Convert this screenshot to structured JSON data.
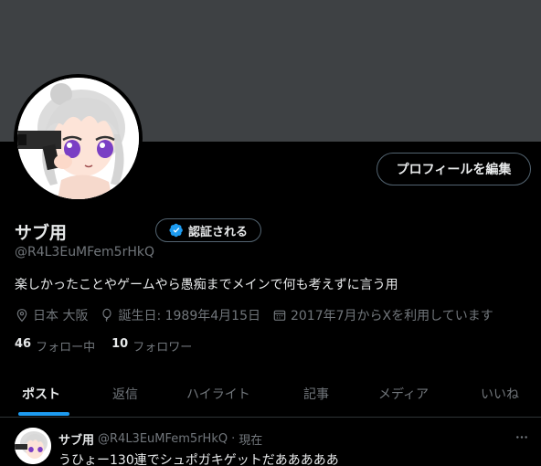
{
  "profile": {
    "display_name": "サブ用",
    "handle": "@R4L3EuMFem5rHkQ",
    "verify_label": "認証される",
    "edit_label": "プロフィールを編集",
    "bio": "楽しかったことやゲームやら愚痴までメインで何も考えずに言う用",
    "location": "日本 大阪",
    "birthday": "誕生日: 1989年4月15日",
    "joined": "2017年7月からXを利用しています",
    "following_count": "46",
    "following_label": "フォロー中",
    "followers_count": "10",
    "followers_label": "フォロワー"
  },
  "tabs": [
    {
      "label": "ポスト"
    },
    {
      "label": "返信"
    },
    {
      "label": "ハイライト"
    },
    {
      "label": "記事"
    },
    {
      "label": "メディア"
    },
    {
      "label": "いいね"
    }
  ],
  "active_tab": 0,
  "tweet": {
    "name": "サブ用",
    "handle": "@R4L3EuMFem5rHkQ",
    "separator": "·",
    "time": "現在",
    "text": "うひょー130連でシュポガキゲットだあああああ"
  },
  "colors": {
    "banner": "#3e4144",
    "accent": "#1d9bf0",
    "text": "#e7e9ea",
    "secondary": "#71767b",
    "border": "#536471"
  },
  "icons": [
    "location-icon",
    "balloon-icon",
    "calendar-icon",
    "verified-badge-icon",
    "more-icon"
  ]
}
